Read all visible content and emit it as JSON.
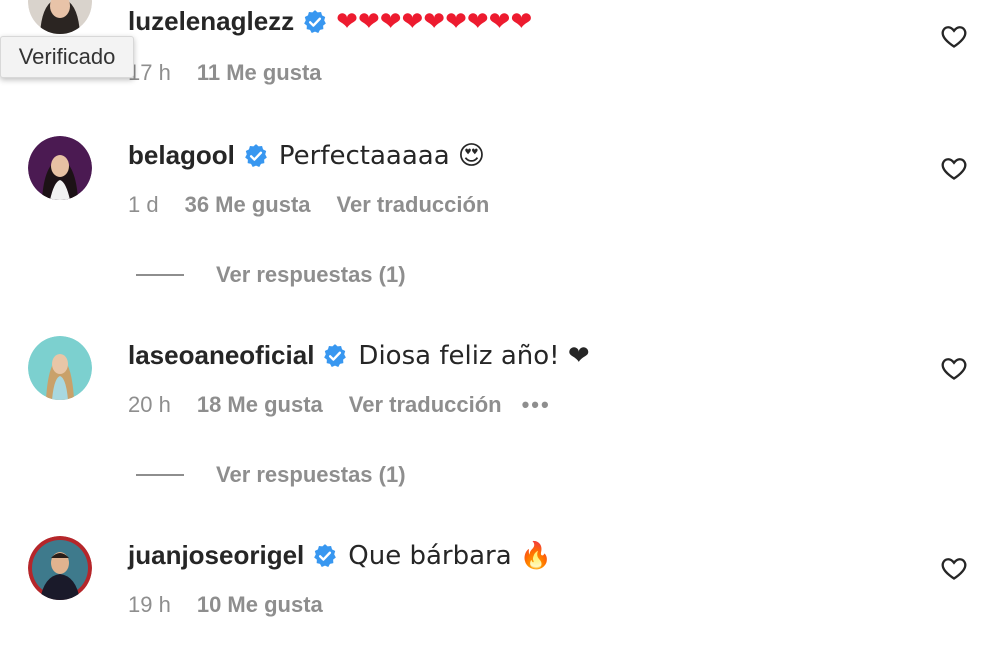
{
  "tooltip": "Verificado",
  "comments": [
    {
      "username": "luzelenaglezz",
      "text": "❤❤❤❤❤❤❤❤❤",
      "time": "17 h",
      "likes": "11 Me gusta"
    },
    {
      "username": "belagool",
      "text": "Perfectaaaaa 😍",
      "time": "1 d",
      "likes": "36 Me gusta",
      "translate": "Ver traducción",
      "replies": "Ver respuestas (1)"
    },
    {
      "username": "laseoaneoficial",
      "text": "Diosa feliz año! ❤",
      "time": "20 h",
      "likes": "18 Me gusta",
      "translate": "Ver traducción",
      "more": "•••",
      "replies": "Ver respuestas (1)"
    },
    {
      "username": "juanjoseorigel",
      "text": "Que bárbara 🔥",
      "time": "19 h",
      "likes": "10 Me gusta"
    }
  ],
  "colors": {
    "verified": "#3897f0",
    "secondary": "#8e8e8e",
    "heart": "#ed1b2f"
  },
  "icons": {
    "verified": "verified-badge-icon",
    "like": "heart-outline-icon"
  }
}
